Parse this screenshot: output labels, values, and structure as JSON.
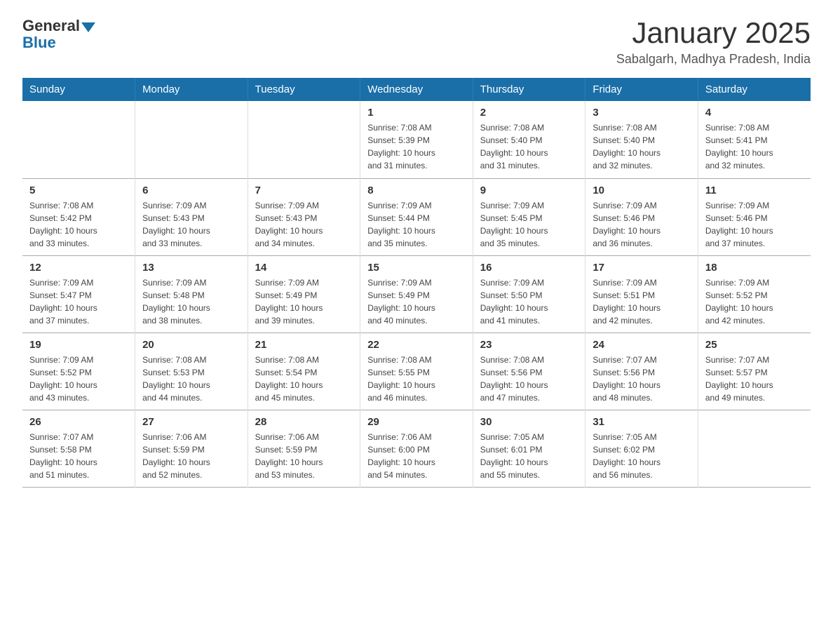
{
  "logo": {
    "text_general": "General",
    "text_blue": "Blue"
  },
  "header": {
    "month_year": "January 2025",
    "location": "Sabalgarh, Madhya Pradesh, India"
  },
  "weekdays": [
    "Sunday",
    "Monday",
    "Tuesday",
    "Wednesday",
    "Thursday",
    "Friday",
    "Saturday"
  ],
  "weeks": [
    [
      {
        "day": "",
        "info": ""
      },
      {
        "day": "",
        "info": ""
      },
      {
        "day": "",
        "info": ""
      },
      {
        "day": "1",
        "info": "Sunrise: 7:08 AM\nSunset: 5:39 PM\nDaylight: 10 hours\nand 31 minutes."
      },
      {
        "day": "2",
        "info": "Sunrise: 7:08 AM\nSunset: 5:40 PM\nDaylight: 10 hours\nand 31 minutes."
      },
      {
        "day": "3",
        "info": "Sunrise: 7:08 AM\nSunset: 5:40 PM\nDaylight: 10 hours\nand 32 minutes."
      },
      {
        "day": "4",
        "info": "Sunrise: 7:08 AM\nSunset: 5:41 PM\nDaylight: 10 hours\nand 32 minutes."
      }
    ],
    [
      {
        "day": "5",
        "info": "Sunrise: 7:08 AM\nSunset: 5:42 PM\nDaylight: 10 hours\nand 33 minutes."
      },
      {
        "day": "6",
        "info": "Sunrise: 7:09 AM\nSunset: 5:43 PM\nDaylight: 10 hours\nand 33 minutes."
      },
      {
        "day": "7",
        "info": "Sunrise: 7:09 AM\nSunset: 5:43 PM\nDaylight: 10 hours\nand 34 minutes."
      },
      {
        "day": "8",
        "info": "Sunrise: 7:09 AM\nSunset: 5:44 PM\nDaylight: 10 hours\nand 35 minutes."
      },
      {
        "day": "9",
        "info": "Sunrise: 7:09 AM\nSunset: 5:45 PM\nDaylight: 10 hours\nand 35 minutes."
      },
      {
        "day": "10",
        "info": "Sunrise: 7:09 AM\nSunset: 5:46 PM\nDaylight: 10 hours\nand 36 minutes."
      },
      {
        "day": "11",
        "info": "Sunrise: 7:09 AM\nSunset: 5:46 PM\nDaylight: 10 hours\nand 37 minutes."
      }
    ],
    [
      {
        "day": "12",
        "info": "Sunrise: 7:09 AM\nSunset: 5:47 PM\nDaylight: 10 hours\nand 37 minutes."
      },
      {
        "day": "13",
        "info": "Sunrise: 7:09 AM\nSunset: 5:48 PM\nDaylight: 10 hours\nand 38 minutes."
      },
      {
        "day": "14",
        "info": "Sunrise: 7:09 AM\nSunset: 5:49 PM\nDaylight: 10 hours\nand 39 minutes."
      },
      {
        "day": "15",
        "info": "Sunrise: 7:09 AM\nSunset: 5:49 PM\nDaylight: 10 hours\nand 40 minutes."
      },
      {
        "day": "16",
        "info": "Sunrise: 7:09 AM\nSunset: 5:50 PM\nDaylight: 10 hours\nand 41 minutes."
      },
      {
        "day": "17",
        "info": "Sunrise: 7:09 AM\nSunset: 5:51 PM\nDaylight: 10 hours\nand 42 minutes."
      },
      {
        "day": "18",
        "info": "Sunrise: 7:09 AM\nSunset: 5:52 PM\nDaylight: 10 hours\nand 42 minutes."
      }
    ],
    [
      {
        "day": "19",
        "info": "Sunrise: 7:09 AM\nSunset: 5:52 PM\nDaylight: 10 hours\nand 43 minutes."
      },
      {
        "day": "20",
        "info": "Sunrise: 7:08 AM\nSunset: 5:53 PM\nDaylight: 10 hours\nand 44 minutes."
      },
      {
        "day": "21",
        "info": "Sunrise: 7:08 AM\nSunset: 5:54 PM\nDaylight: 10 hours\nand 45 minutes."
      },
      {
        "day": "22",
        "info": "Sunrise: 7:08 AM\nSunset: 5:55 PM\nDaylight: 10 hours\nand 46 minutes."
      },
      {
        "day": "23",
        "info": "Sunrise: 7:08 AM\nSunset: 5:56 PM\nDaylight: 10 hours\nand 47 minutes."
      },
      {
        "day": "24",
        "info": "Sunrise: 7:07 AM\nSunset: 5:56 PM\nDaylight: 10 hours\nand 48 minutes."
      },
      {
        "day": "25",
        "info": "Sunrise: 7:07 AM\nSunset: 5:57 PM\nDaylight: 10 hours\nand 49 minutes."
      }
    ],
    [
      {
        "day": "26",
        "info": "Sunrise: 7:07 AM\nSunset: 5:58 PM\nDaylight: 10 hours\nand 51 minutes."
      },
      {
        "day": "27",
        "info": "Sunrise: 7:06 AM\nSunset: 5:59 PM\nDaylight: 10 hours\nand 52 minutes."
      },
      {
        "day": "28",
        "info": "Sunrise: 7:06 AM\nSunset: 5:59 PM\nDaylight: 10 hours\nand 53 minutes."
      },
      {
        "day": "29",
        "info": "Sunrise: 7:06 AM\nSunset: 6:00 PM\nDaylight: 10 hours\nand 54 minutes."
      },
      {
        "day": "30",
        "info": "Sunrise: 7:05 AM\nSunset: 6:01 PM\nDaylight: 10 hours\nand 55 minutes."
      },
      {
        "day": "31",
        "info": "Sunrise: 7:05 AM\nSunset: 6:02 PM\nDaylight: 10 hours\nand 56 minutes."
      },
      {
        "day": "",
        "info": ""
      }
    ]
  ]
}
